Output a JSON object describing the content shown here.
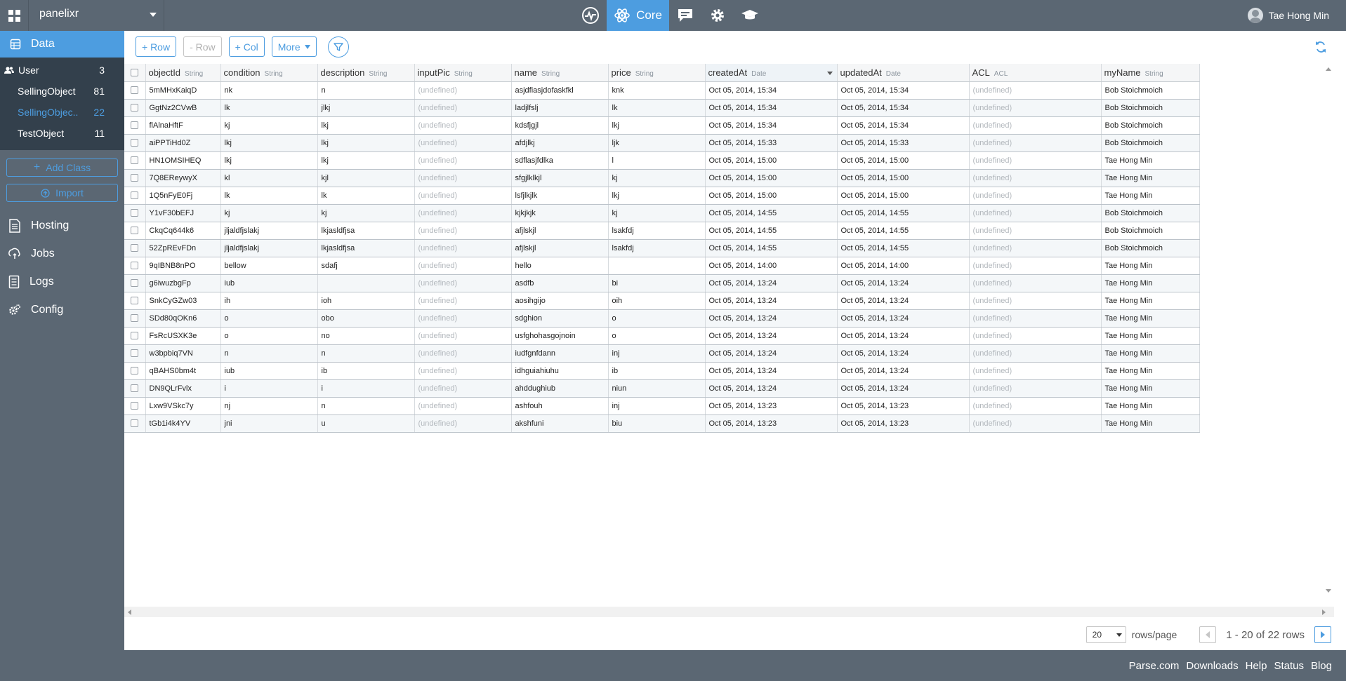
{
  "topbar": {
    "app_name": "panelixr",
    "core_label": "Core",
    "user_name": "Tae Hong Min"
  },
  "sidebar": {
    "data_label": "Data",
    "classes": [
      {
        "name": "User",
        "count": "3"
      },
      {
        "name": "SellingObject",
        "count": "81"
      },
      {
        "name": "SellingObjec..",
        "count": "22"
      },
      {
        "name": "TestObject",
        "count": "11"
      }
    ],
    "add_class_label": "Add Class",
    "import_label": "Import",
    "nav": [
      {
        "label": "Hosting",
        "icon": "hosting-icon"
      },
      {
        "label": "Jobs",
        "icon": "jobs-icon"
      },
      {
        "label": "Logs",
        "icon": "logs-icon"
      },
      {
        "label": "Config",
        "icon": "config-icon"
      }
    ]
  },
  "toolbar": {
    "add_row": "+ Row",
    "remove_row": "- Row",
    "add_col": "+ Col",
    "more": "More"
  },
  "table": {
    "columns": [
      {
        "name": "objectId",
        "type": "String"
      },
      {
        "name": "condition",
        "type": "String"
      },
      {
        "name": "description",
        "type": "String"
      },
      {
        "name": "inputPic",
        "type": "String"
      },
      {
        "name": "name",
        "type": "String"
      },
      {
        "name": "price",
        "type": "String"
      },
      {
        "name": "createdAt",
        "type": "Date"
      },
      {
        "name": "updatedAt",
        "type": "Date"
      },
      {
        "name": "ACL",
        "type": "ACL"
      },
      {
        "name": "myName",
        "type": "String"
      }
    ],
    "undefined_text": "(undefined)",
    "rows": [
      [
        "5mMHxKaiqD",
        "nk",
        "n",
        "(undefined)",
        "asjdfiasjdofaskfkl",
        "knk",
        "Oct 05, 2014, 15:34",
        "Oct 05, 2014, 15:34",
        "(undefined)",
        "Bob Stoichmoich"
      ],
      [
        "GgtNz2CVwB",
        "lk",
        "jlkj",
        "(undefined)",
        "ladjlfslj",
        "lk",
        "Oct 05, 2014, 15:34",
        "Oct 05, 2014, 15:34",
        "(undefined)",
        "Bob Stoichmoich"
      ],
      [
        "flAlnaHftF",
        "kj",
        "lkj",
        "(undefined)",
        "kdsfjgjl",
        "lkj",
        "Oct 05, 2014, 15:34",
        "Oct 05, 2014, 15:34",
        "(undefined)",
        "Bob Stoichmoich"
      ],
      [
        "aiPPTiHd0Z",
        "lkj",
        "lkj",
        "(undefined)",
        "afdjlkj",
        "ljk",
        "Oct 05, 2014, 15:33",
        "Oct 05, 2014, 15:33",
        "(undefined)",
        "Bob Stoichmoich"
      ],
      [
        "HN1OMSIHEQ",
        "lkj",
        "lkj",
        "(undefined)",
        "sdflasjfdlka",
        "l",
        "Oct 05, 2014, 15:00",
        "Oct 05, 2014, 15:00",
        "(undefined)",
        "Tae Hong Min"
      ],
      [
        "7Q8EReywyX",
        "kl",
        "kjl",
        "(undefined)",
        "sfgjlklkjl",
        "kj",
        "Oct 05, 2014, 15:00",
        "Oct 05, 2014, 15:00",
        "(undefined)",
        "Tae Hong Min"
      ],
      [
        "1Q5nFyE0Fj",
        "lk",
        "lk",
        "(undefined)",
        "lsfjlkjlk",
        "lkj",
        "Oct 05, 2014, 15:00",
        "Oct 05, 2014, 15:00",
        "(undefined)",
        "Tae Hong Min"
      ],
      [
        "Y1vF30bEFJ",
        "kj",
        "kj",
        "(undefined)",
        "kjkjkjk",
        "kj",
        "Oct 05, 2014, 14:55",
        "Oct 05, 2014, 14:55",
        "(undefined)",
        "Bob Stoichmoich"
      ],
      [
        "CkqCq644k6",
        "jljaldfjslakj",
        "lkjasldfjsa",
        "(undefined)",
        "afjlskjl",
        "lsakfdj",
        "Oct 05, 2014, 14:55",
        "Oct 05, 2014, 14:55",
        "(undefined)",
        "Bob Stoichmoich"
      ],
      [
        "52ZpREvFDn",
        "jljaldfjslakj",
        "lkjasldfjsa",
        "(undefined)",
        "afjlskjl",
        "lsakfdj",
        "Oct 05, 2014, 14:55",
        "Oct 05, 2014, 14:55",
        "(undefined)",
        "Bob Stoichmoich"
      ],
      [
        "9qIBNB8nPO",
        "bellow",
        "sdafj",
        "(undefined)",
        "hello",
        "",
        "Oct 05, 2014, 14:00",
        "Oct 05, 2014, 14:00",
        "(undefined)",
        "Tae Hong Min"
      ],
      [
        "g6iwuzbgFp",
        "iub",
        "",
        "(undefined)",
        "asdfb",
        "bi",
        "Oct 05, 2014, 13:24",
        "Oct 05, 2014, 13:24",
        "(undefined)",
        "Tae Hong Min"
      ],
      [
        "SnkCyGZw03",
        "ih",
        "ioh",
        "(undefined)",
        "aosihgijo",
        "oih",
        "Oct 05, 2014, 13:24",
        "Oct 05, 2014, 13:24",
        "(undefined)",
        "Tae Hong Min"
      ],
      [
        "SDd80qOKn6",
        "o",
        "obo",
        "(undefined)",
        "sdghion",
        "o",
        "Oct 05, 2014, 13:24",
        "Oct 05, 2014, 13:24",
        "(undefined)",
        "Tae Hong Min"
      ],
      [
        "FsRcUSXK3e",
        "o",
        "no",
        "(undefined)",
        "usfghohasgojnoin",
        "o",
        "Oct 05, 2014, 13:24",
        "Oct 05, 2014, 13:24",
        "(undefined)",
        "Tae Hong Min"
      ],
      [
        "w3bpbiq7VN",
        "n",
        "n",
        "(undefined)",
        "iudfgnfdann",
        "inj",
        "Oct 05, 2014, 13:24",
        "Oct 05, 2014, 13:24",
        "(undefined)",
        "Tae Hong Min"
      ],
      [
        "qBAHS0bm4t",
        "iub",
        "ib",
        "(undefined)",
        "idhguiahiuhu",
        "ib",
        "Oct 05, 2014, 13:24",
        "Oct 05, 2014, 13:24",
        "(undefined)",
        "Tae Hong Min"
      ],
      [
        "DN9QLrFvlx",
        "i",
        "i",
        "(undefined)",
        "ahddughiub",
        "niun",
        "Oct 05, 2014, 13:24",
        "Oct 05, 2014, 13:24",
        "(undefined)",
        "Tae Hong Min"
      ],
      [
        "Lxw9VSkc7y",
        "nj",
        "n",
        "(undefined)",
        "ashfouh",
        "inj",
        "Oct 05, 2014, 13:23",
        "Oct 05, 2014, 13:23",
        "(undefined)",
        "Tae Hong Min"
      ],
      [
        "tGb1i4k4YV",
        "jni",
        "u",
        "(undefined)",
        "akshfuni",
        "biu",
        "Oct 05, 2014, 13:23",
        "Oct 05, 2014, 13:23",
        "(undefined)",
        "Tae Hong Min"
      ]
    ]
  },
  "pagination": {
    "rows_per_page": "20",
    "rows_per_page_label": "rows/page",
    "range_text": "1 - 20 of 22 rows"
  },
  "footer": {
    "links": [
      "Parse.com",
      "Downloads",
      "Help",
      "Status",
      "Blog"
    ]
  },
  "colors": {
    "accent": "#4d9de0",
    "chrome": "#5b6773",
    "sidebar_dark": "#33404c"
  }
}
